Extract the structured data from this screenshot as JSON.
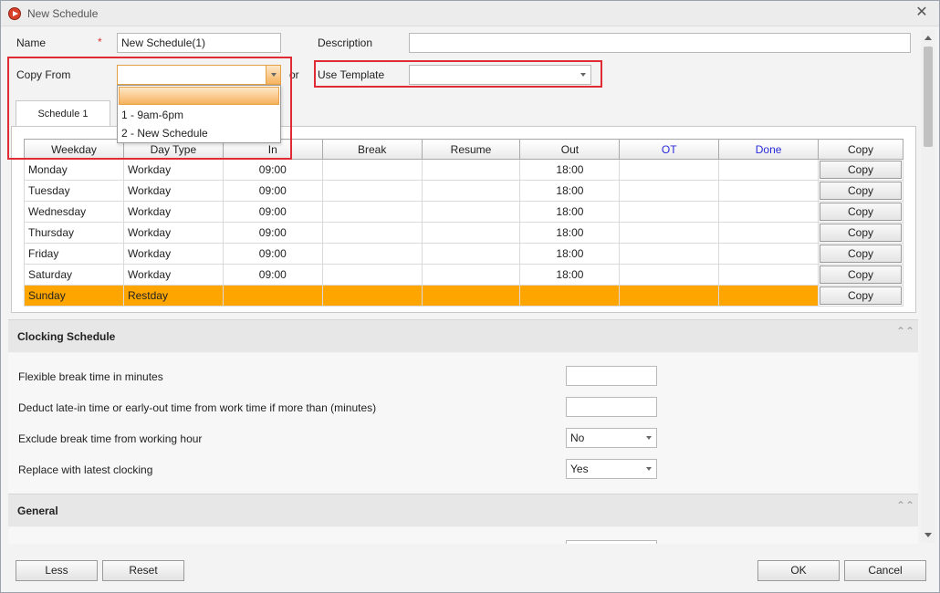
{
  "window": {
    "title": "New Schedule",
    "close_glyph": "✕"
  },
  "form": {
    "name_label": "Name",
    "required_mark": "*",
    "name_value": "New Schedule(1)",
    "description_label": "Description",
    "description_value": "",
    "copy_from_label": "Copy From",
    "copy_from_value": "",
    "or_label": "or",
    "use_template_label": "Use Template",
    "use_template_value": ""
  },
  "copy_from_dropdown": {
    "options": [
      "",
      "1 - 9am-6pm",
      "2 - New Schedule"
    ]
  },
  "tabs": [
    {
      "label": "Schedule 1"
    }
  ],
  "schedule_table": {
    "columns": [
      "Weekday",
      "Day Type",
      "In",
      "Break",
      "Resume",
      "Out",
      "OT",
      "Done",
      "Copy"
    ],
    "rows": [
      {
        "weekday": "Monday",
        "day_type": "Workday",
        "in": "09:00",
        "break": "",
        "resume": "",
        "out": "18:00",
        "ot": "",
        "done": "",
        "copy": "Copy"
      },
      {
        "weekday": "Tuesday",
        "day_type": "Workday",
        "in": "09:00",
        "break": "",
        "resume": "",
        "out": "18:00",
        "ot": "",
        "done": "",
        "copy": "Copy"
      },
      {
        "weekday": "Wednesday",
        "day_type": "Workday",
        "in": "09:00",
        "break": "",
        "resume": "",
        "out": "18:00",
        "ot": "",
        "done": "",
        "copy": "Copy"
      },
      {
        "weekday": "Thursday",
        "day_type": "Workday",
        "in": "09:00",
        "break": "",
        "resume": "",
        "out": "18:00",
        "ot": "",
        "done": "",
        "copy": "Copy"
      },
      {
        "weekday": "Friday",
        "day_type": "Workday",
        "in": "09:00",
        "break": "",
        "resume": "",
        "out": "18:00",
        "ot": "",
        "done": "",
        "copy": "Copy"
      },
      {
        "weekday": "Saturday",
        "day_type": "Workday",
        "in": "09:00",
        "break": "",
        "resume": "",
        "out": "18:00",
        "ot": "",
        "done": "",
        "copy": "Copy"
      },
      {
        "weekday": "Sunday",
        "day_type": "Restday",
        "in": "",
        "break": "",
        "resume": "",
        "out": "",
        "ot": "",
        "done": "",
        "copy": "Copy"
      }
    ],
    "highlight_color": "#FFA500",
    "link_header_color": "#2A2ADB"
  },
  "clocking_schedule": {
    "title": "Clocking Schedule",
    "collapse_glyph": "⌃⌃",
    "fields": {
      "flexible_break": {
        "label": "Flexible break time in minutes",
        "value": ""
      },
      "deduct_late": {
        "label": "Deduct late-in time or early-out time from work time if more than (minutes)",
        "value": ""
      },
      "exclude_break": {
        "label": "Exclude break time from working hour",
        "value": "No"
      },
      "replace_latest": {
        "label": "Replace with latest clocking",
        "value": "Yes"
      }
    }
  },
  "general": {
    "title": "General",
    "collapse_glyph": "⌃⌃"
  },
  "footer": {
    "less": "Less",
    "reset": "Reset",
    "ok": "OK",
    "cancel": "Cancel"
  },
  "accent_colors": {
    "highlight_box": "#E02B35",
    "dropdown_selected": "#F6B25D"
  }
}
